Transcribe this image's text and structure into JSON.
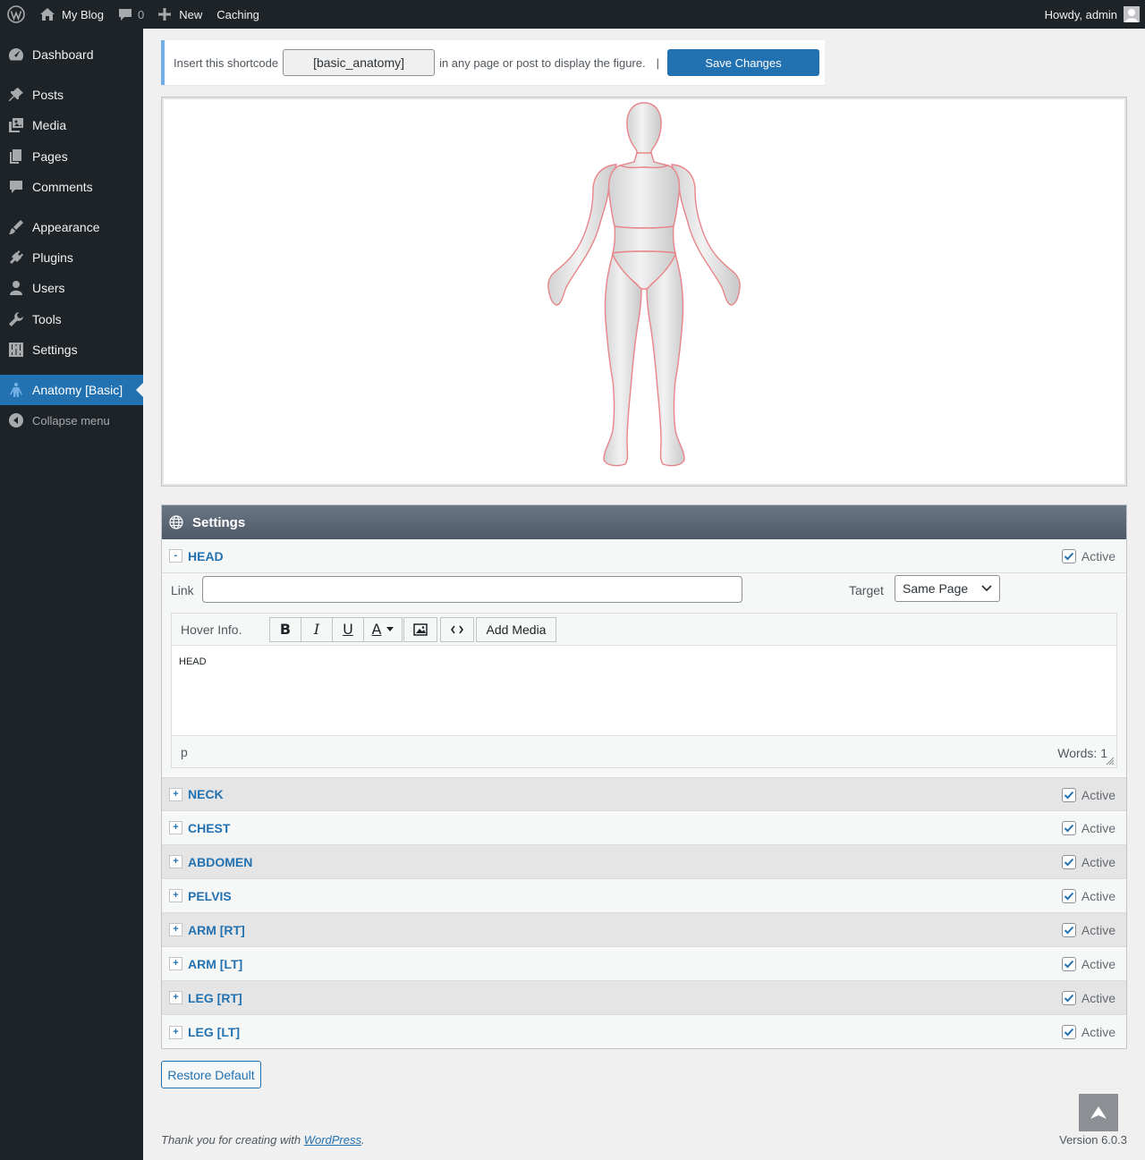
{
  "adminbar": {
    "site_name": "My Blog",
    "comments_count": "0",
    "new_label": "New",
    "caching_label": "Caching",
    "howdy": "Howdy, admin"
  },
  "sidebar": {
    "items": [
      {
        "label": "Dashboard",
        "icon": "dashboard-icon"
      },
      {
        "label": "Posts",
        "icon": "pin-icon"
      },
      {
        "label": "Media",
        "icon": "media-icon"
      },
      {
        "label": "Pages",
        "icon": "pages-icon"
      },
      {
        "label": "Comments",
        "icon": "comment-icon"
      },
      {
        "label": "Appearance",
        "icon": "brush-icon"
      },
      {
        "label": "Plugins",
        "icon": "plug-icon"
      },
      {
        "label": "Users",
        "icon": "user-icon"
      },
      {
        "label": "Tools",
        "icon": "wrench-icon"
      },
      {
        "label": "Settings",
        "icon": "sliders-icon"
      },
      {
        "label": "Anatomy [Basic]",
        "icon": "person-icon"
      }
    ],
    "collapse_label": "Collapse menu",
    "accent": "#2271b1"
  },
  "shortcode": {
    "prefix": "Insert this shortcode",
    "code": "[basic_anatomy]",
    "suffix": "in any page or post to display the figure.",
    "separator": "|",
    "save_label": "Save Changes"
  },
  "settings": {
    "title": "Settings",
    "active_label": "Active",
    "regions": [
      {
        "name": "HEAD",
        "toggle": "-",
        "active": true
      },
      {
        "name": "NECK",
        "toggle": "+",
        "active": true
      },
      {
        "name": "CHEST",
        "toggle": "+",
        "active": true
      },
      {
        "name": "ABDOMEN",
        "toggle": "+",
        "active": true
      },
      {
        "name": "PELVIS",
        "toggle": "+",
        "active": true
      },
      {
        "name": "ARM [RT]",
        "toggle": "+",
        "active": true
      },
      {
        "name": "ARM [LT]",
        "toggle": "+",
        "active": true
      },
      {
        "name": "LEG [RT]",
        "toggle": "+",
        "active": true
      },
      {
        "name": "LEG [LT]",
        "toggle": "+",
        "active": true
      }
    ],
    "link_label": "Link",
    "link_value": "",
    "target_label": "Target",
    "target_value": "Same Page",
    "editor": {
      "hover_label": "Hover Info.",
      "add_media": "Add Media",
      "content": "HEAD",
      "path": "p",
      "words": "Words: 1"
    }
  },
  "restore_label": "Restore Default",
  "footer": {
    "thanks_prefix": "Thank you for creating with",
    "wp_link": "WordPress",
    "thanks_suffix": ".",
    "version": "Version 6.0.3"
  }
}
